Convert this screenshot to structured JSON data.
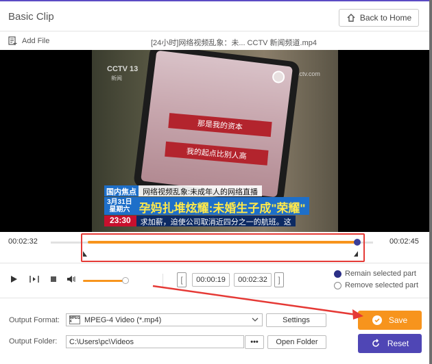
{
  "window": {
    "title": "Basic Clip",
    "back_label": "Back to Home"
  },
  "filebar": {
    "add_file_label": "Add File",
    "filename": "[24小时]网络视频乱象：未... CCTV 新闻频道.mp4"
  },
  "video": {
    "channel_logo": "CCTV 13",
    "channel_sub": "新闻",
    "watermark": "cctv.com",
    "band_text_1": "那是我的资本",
    "band_text_2": "我的起点比别人高",
    "ticker_label": "国内焦点",
    "ticker_line": "网络视频乱象:未成年人的网络直播",
    "date_line_1": "3月31日",
    "date_line_2": "星期六",
    "headline": "孕妈扎堆炫耀:未婚生子成\"荣耀\"",
    "clock": "23:30",
    "scroll_text": "求加薪，迫使公司取消近四分之一的航班。这"
  },
  "timeline": {
    "start_time": "00:02:32",
    "end_time": "00:02:45",
    "selection_start_fraction": 0.0,
    "selection_end_fraction": 1.0
  },
  "controls": {
    "volume_fraction": 0.95,
    "range_start": "00:00:19",
    "range_end": "00:02:32",
    "remain_label": "Remain selected part",
    "remove_label": "Remove selected part",
    "selected_mode": "remain"
  },
  "output": {
    "format_label": "Output Format:",
    "format_value": "MPEG-4 Video (*.mp4)",
    "format_icon_text": "MPEG 4",
    "settings_label": "Settings",
    "folder_label": "Output Folder:",
    "folder_value": "C:\\Users\\pc\\Videos",
    "browse_label": "•••",
    "open_folder_label": "Open Folder",
    "save_label": "Save",
    "reset_label": "Reset"
  },
  "colors": {
    "accent_orange": "#f7941d",
    "accent_purple": "#4f46b5",
    "annotation_red": "#e53935"
  }
}
